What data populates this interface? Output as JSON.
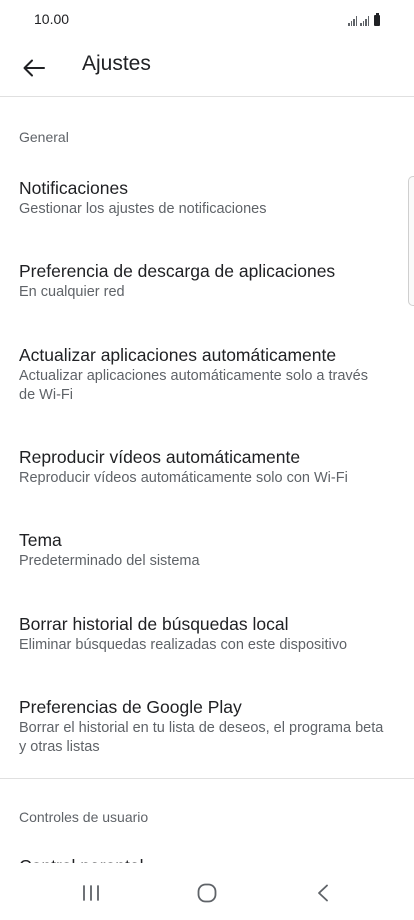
{
  "status_bar": {
    "time": "10.00"
  },
  "app_bar": {
    "title": "Ajustes",
    "back_icon": "arrow-left-icon"
  },
  "sections": [
    {
      "header": "General",
      "items": [
        {
          "title": "Notificaciones",
          "subtitle": "Gestionar los ajustes de notificaciones"
        },
        {
          "title": "Preferencia de descarga de aplicaciones",
          "subtitle": "En cualquier red"
        },
        {
          "title": "Actualizar aplicaciones automáticamente",
          "subtitle": "Actualizar aplicaciones automáticamente solo a través de Wi-Fi"
        },
        {
          "title": "Reproducir vídeos automáticamente",
          "subtitle": "Reproducir vídeos automáticamente solo con Wi-Fi"
        },
        {
          "title": "Tema",
          "subtitle": "Predeterminado del sistema"
        },
        {
          "title": "Borrar historial de búsquedas local",
          "subtitle": "Eliminar búsquedas realizadas con este dispositivo"
        },
        {
          "title": "Preferencias de Google Play",
          "subtitle": "Borrar el historial en tu lista de deseos, el programa beta y otras listas"
        }
      ]
    },
    {
      "header": "Controles de usuario",
      "items": [
        {
          "title": "Control parental"
        }
      ]
    }
  ],
  "nav_bar": {
    "recents_icon": "recents-icon",
    "home_icon": "home-icon",
    "back_icon": "back-chevron-icon"
  }
}
